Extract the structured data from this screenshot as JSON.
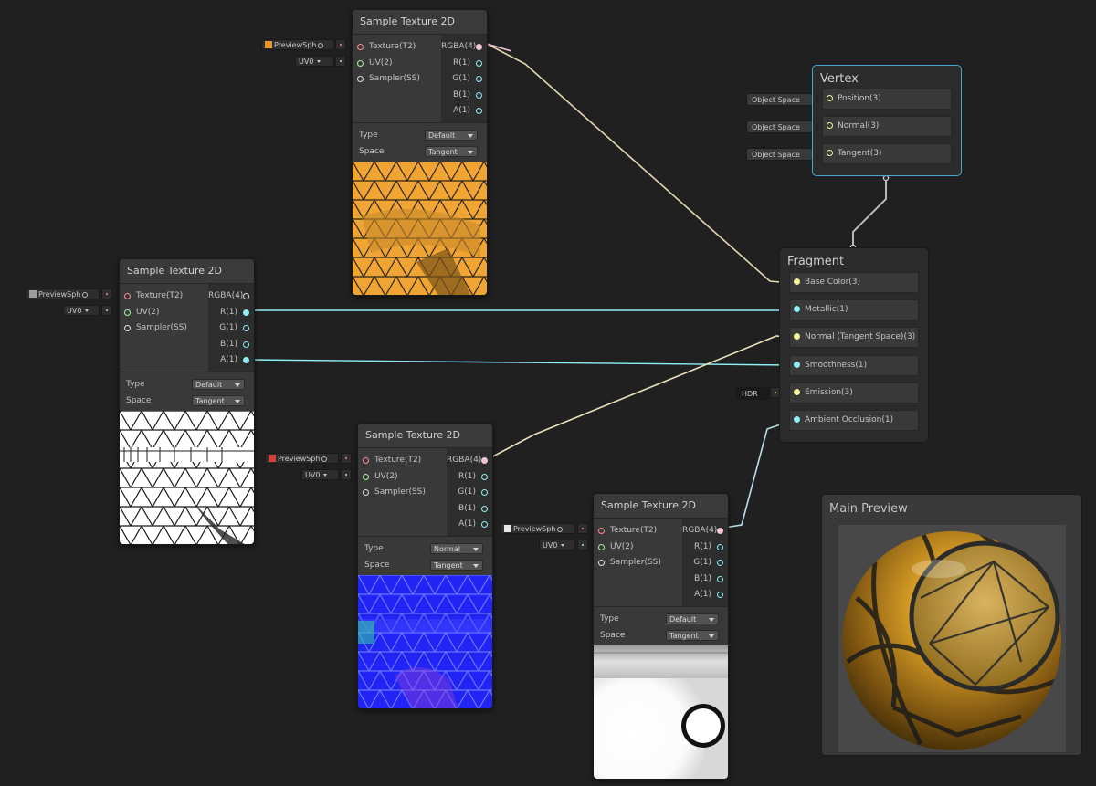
{
  "colors": {
    "background": "#202020",
    "node": "#393939",
    "selected_border": "#44a6d4",
    "wire_pink": "#f2c6d8",
    "wire_cyan": "#8ff0f8",
    "wire_yellow": "#f3f3a0",
    "wire_grey": "#c8c8c8"
  },
  "nodes": {
    "albedo": {
      "title": "Sample Texture 2D",
      "inputs": [
        "Texture(T2)",
        "UV(2)",
        "Sampler(SS)"
      ],
      "outputs": [
        "RGBA(4)",
        "R(1)",
        "G(1)",
        "B(1)",
        "A(1)"
      ],
      "type_label": "Type",
      "type_value": "Default",
      "space_label": "Space",
      "space_value": "Tangent",
      "texture_field": "PreviewSph",
      "uv_field": "UV0"
    },
    "mask": {
      "title": "Sample Texture 2D",
      "inputs": [
        "Texture(T2)",
        "UV(2)",
        "Sampler(SS)"
      ],
      "outputs": [
        "RGBA(4)",
        "R(1)",
        "G(1)",
        "B(1)",
        "A(1)"
      ],
      "type_label": "Type",
      "type_value": "Default",
      "space_label": "Space",
      "space_value": "Tangent",
      "texture_field": "PreviewSph",
      "uv_field": "UV0"
    },
    "normal": {
      "title": "Sample Texture 2D",
      "inputs": [
        "Texture(T2)",
        "UV(2)",
        "Sampler(SS)"
      ],
      "outputs": [
        "RGBA(4)",
        "R(1)",
        "G(1)",
        "B(1)",
        "A(1)"
      ],
      "type_label": "Type",
      "type_value": "Normal",
      "space_label": "Space",
      "space_value": "Tangent",
      "texture_field": "PreviewSph",
      "uv_field": "UV0"
    },
    "occlusion": {
      "title": "Sample Texture 2D",
      "inputs": [
        "Texture(T2)",
        "UV(2)",
        "Sampler(SS)"
      ],
      "outputs": [
        "RGBA(4)",
        "R(1)",
        "G(1)",
        "B(1)",
        "A(1)"
      ],
      "type_label": "Type",
      "type_value": "Default",
      "space_label": "Space",
      "space_value": "Tangent",
      "texture_field": "PreviewSph",
      "uv_field": "UV0"
    }
  },
  "vertex": {
    "title": "Vertex",
    "blocks": [
      "Position(3)",
      "Normal(3)",
      "Tangent(3)"
    ],
    "space_tag": "Object Space"
  },
  "fragment": {
    "title": "Fragment",
    "blocks": [
      "Base Color(3)",
      "Metallic(1)",
      "Normal (Tangent Space)(3)",
      "Smoothness(1)",
      "Emission(3)",
      "Ambient Occlusion(1)"
    ],
    "emission_tag": "HDR"
  },
  "main_preview": {
    "title": "Main Preview"
  }
}
